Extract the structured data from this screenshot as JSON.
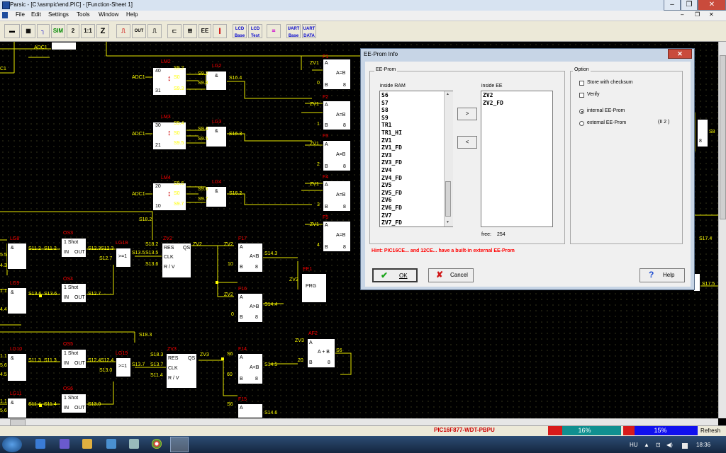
{
  "window": {
    "title": "Parsic - [C:\\asmpic\\end.PIC] - [Function-Sheet 1]"
  },
  "menu": [
    "File",
    "Edit",
    "Settings",
    "Tools",
    "Window",
    "Help"
  ],
  "toolbar": {
    "sim": "SIM",
    "z2": "2",
    "one_to_one": "1:1",
    "z": "Z",
    "out": "OUT",
    "ee": "EE",
    "lcd_base_1": "LCD",
    "lcd_base_2": "Base",
    "lcd_test_1": "LCD",
    "lcd_test_2": "Test",
    "uart_base_1": "UART",
    "uart_base_2": "Base",
    "uart_data_1": "UART",
    "uart_data_2": "DATA"
  },
  "canvas": {
    "labels_red": [
      "LM2",
      "LM3",
      "LM4",
      "OS3",
      "LG18",
      "ZV2",
      "F17",
      "EE1",
      "F16",
      "OS4",
      "OS5",
      "LG19",
      "ZV3",
      "AF2",
      "F14",
      "F15",
      "OS6",
      "LG9",
      "LG10",
      "LG11",
      "LG8",
      "F1",
      "F2",
      "F3",
      "F4",
      "F5"
    ],
    "top_labels": {
      "adc1_top": "ADC1",
      "c1": "C1"
    },
    "lm2": {
      "adc": "ADC1",
      "v1": "40",
      "v2": "31",
      "s_a": "S9.2",
      "s_b": "S0",
      "s_c": "S9.3",
      "lg": "LG2",
      "out": "S16.4"
    },
    "lm3": {
      "adc": "ADC1",
      "v1": "30",
      "v2": "21",
      "s_a": "S9.4",
      "s_b": "S0",
      "s_c": "S9.5",
      "lg": "LG3",
      "out": "S16.3"
    },
    "lm4": {
      "adc": "ADC1",
      "v1": "20",
      "v2": "10",
      "s_a": "S9.6",
      "s_b": "S0",
      "s_c": "S9.7",
      "lg": "LG4",
      "out": "S16.2"
    },
    "zv_left": [
      "ZV1",
      "ZV1",
      "ZV1",
      "ZV1",
      "ZV1"
    ],
    "cmp_vals": [
      "0",
      "1",
      "2",
      "3",
      "4"
    ],
    "amp": "&",
    "aeqb": "A=B",
    "altb": "A<B",
    "agtb": "A>B",
    "aplusb": "A + B",
    "a": "A",
    "b": "B",
    "eight": "8",
    "one_shot": "1 Shot",
    "in": "IN",
    "out": "OUT",
    "ge1": ">=1",
    "res": "RES",
    "qs": "QS",
    "clk": "CLK",
    "rv": "R / V",
    "prg": "PRG",
    "s18_2": "S18.2",
    "s18_3": "S18.3",
    "s11_2": "S11.2",
    "s11_3": "S11.3",
    "s11_4": "S11.4",
    "s12_3": "S12.3",
    "s12_4": "S12.4",
    "s12_7": "S12.7",
    "s13_5": "S13.5",
    "s13_6": "S13.6",
    "s13_7": "S13.7",
    "s13_0": "S13.0",
    "s14_3": "S14.3",
    "s14_4": "S14.4",
    "s14_5": "S14.5",
    "s14_6": "S14.6",
    "zv2": "ZV2",
    "zv3": "ZV3",
    "s6": "S6",
    "s8": "S8",
    "n10": "10",
    "n0": "0",
    "n20": "20",
    "n60": "60",
    "s17_4": "S17.4",
    "s17_5": "S17.5",
    "left_vals": [
      "5.5",
      "4.3",
      "1.1",
      "4.4",
      "1.1",
      "5.6",
      "4.5",
      "1.1",
      "5.6"
    ]
  },
  "dialog": {
    "title": "EE-Prom Info",
    "eeprom_group": "EE-Prom",
    "inside_ram_label": "inside RAM",
    "inside_ee_label": "inside EE",
    "ram_items": [
      "S6",
      "S7",
      "S8",
      "S9",
      "TR1",
      "TR1_HI",
      "ZV1",
      "ZV1_FD",
      "ZV3",
      "ZV3_FD",
      "ZV4",
      "ZV4_FD",
      "ZV5",
      "ZV5_FD",
      "ZV6",
      "ZV6_FD",
      "ZV7",
      "ZV7_FD"
    ],
    "ee_items": [
      "ZV2",
      "ZV2_FD"
    ],
    "move_right": ">",
    "move_left": "<",
    "free_label": "free:",
    "free_value": "254",
    "hint": "Hint: PIC16CE... and 12CE... have a built-in external EE-Prom",
    "option_group": "Option",
    "store_checksum": "Store with checksum",
    "verify": "Verify",
    "internal": "internal EE-Prom",
    "external": "external EE-Prom",
    "i2c": "(II 2 )",
    "ok": "OK",
    "cancel": "Cancel",
    "help": "Help"
  },
  "status": {
    "chip": "PIC16F877-WDT-PBPU",
    "bar1_percent": "16%",
    "bar2_percent": "15%",
    "refresh": "Refresh"
  },
  "taskbar": {
    "lang": "HU",
    "time": "18:36"
  },
  "colors": {
    "wire": "#e8e800",
    "dialog_hint": "#ff0000",
    "canvas_bg": "#000000"
  }
}
